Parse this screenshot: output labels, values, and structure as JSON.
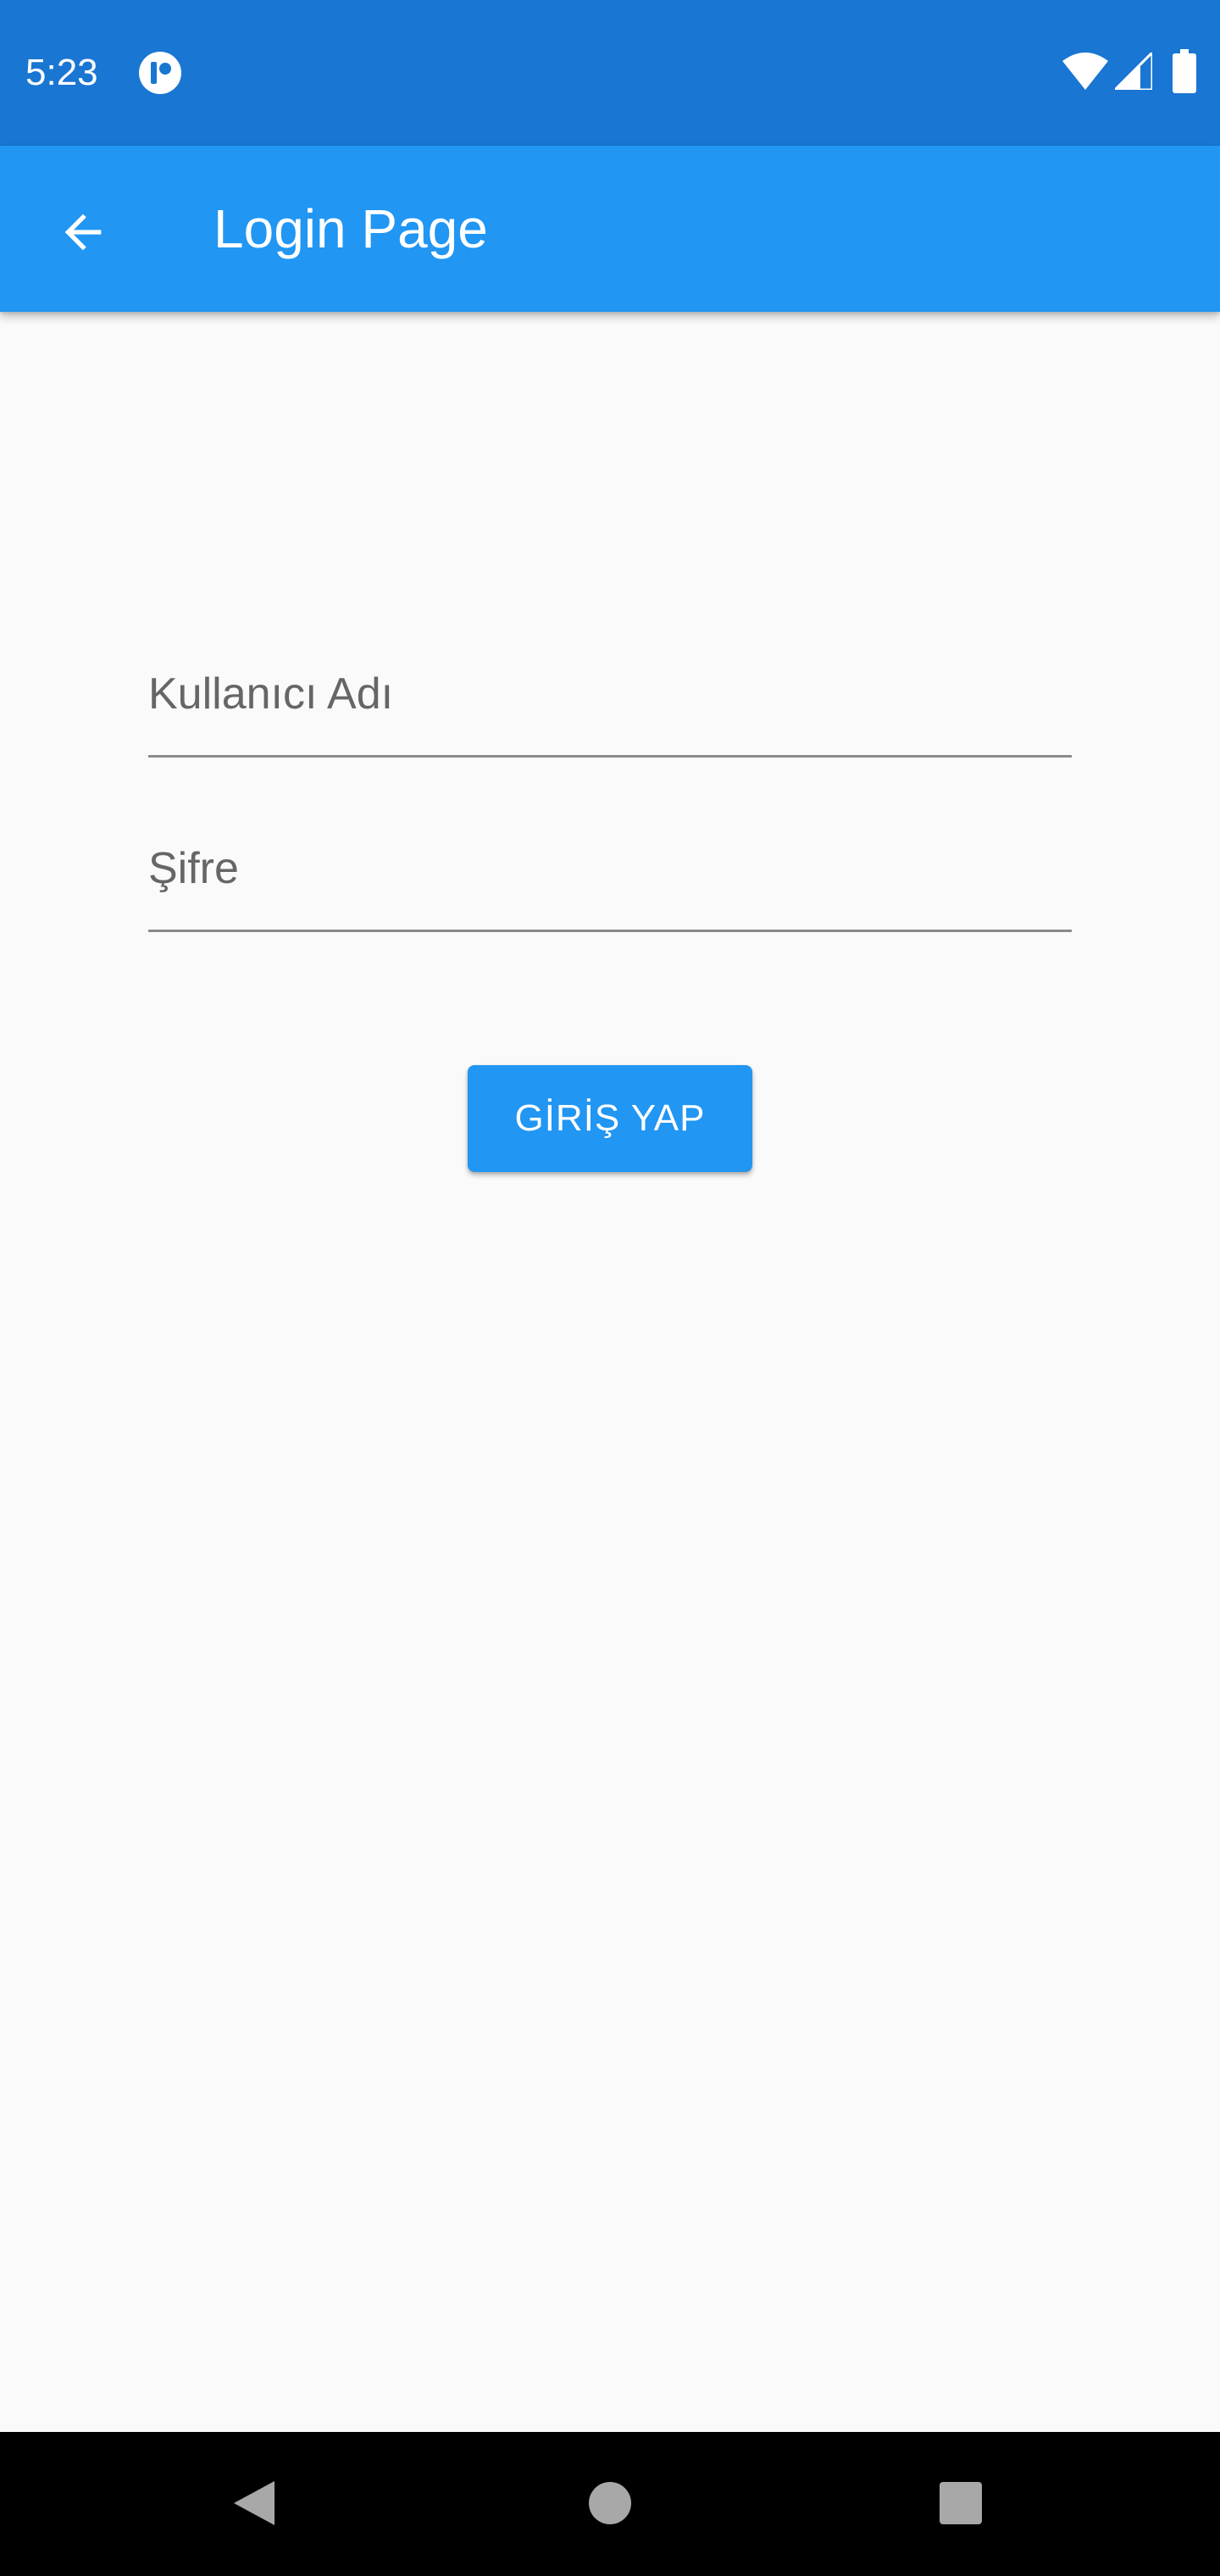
{
  "status_bar": {
    "time": "5:23",
    "app_icon": "notification-app-icon",
    "icons": [
      "wifi-icon",
      "cellular-signal-icon",
      "battery-icon"
    ],
    "background": "#1976d2"
  },
  "app_bar": {
    "title": "Login Page",
    "back_icon": "arrow-back-icon",
    "background": "#2196f3"
  },
  "form": {
    "username": {
      "label": "Kullanıcı Adı",
      "value": ""
    },
    "password": {
      "label": "Şifre",
      "value": ""
    },
    "submit_label": "GİRİŞ YAP",
    "accent": "#2196f3"
  },
  "nav_bar": {
    "icons": [
      "nav-back-icon",
      "nav-home-icon",
      "nav-recents-icon"
    ]
  }
}
